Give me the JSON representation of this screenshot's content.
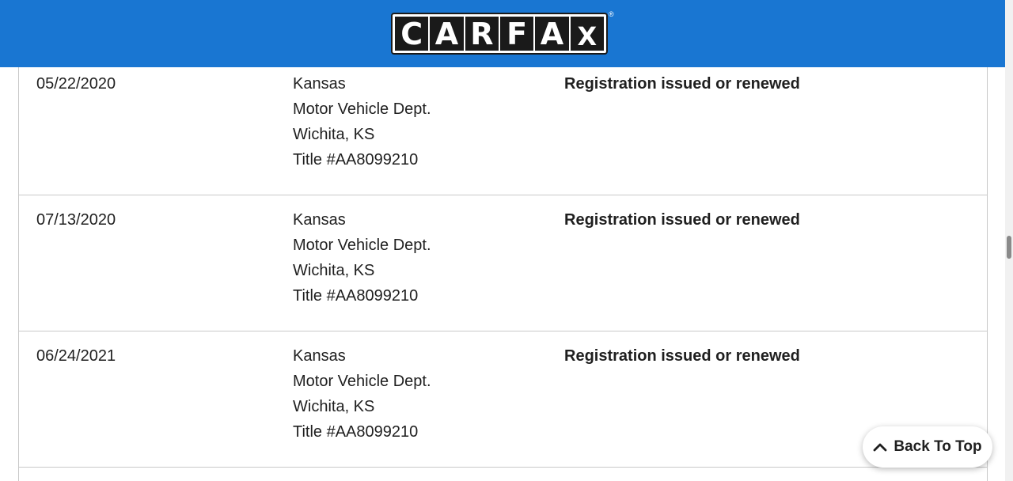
{
  "header": {
    "brand_letters": [
      "C",
      "A",
      "R",
      "F",
      "A",
      "X"
    ],
    "registered_mark": "®",
    "background_color": "#1976d2"
  },
  "records": [
    {
      "date": "05/22/2020",
      "source": [
        "Kansas",
        "Motor Vehicle Dept.",
        "Wichita, KS",
        "Title #AA8099210"
      ],
      "event": "Registration issued or renewed"
    },
    {
      "date": "07/13/2020",
      "source": [
        "Kansas",
        "Motor Vehicle Dept.",
        "Wichita, KS",
        "Title #AA8099210"
      ],
      "event": "Registration issued or renewed"
    },
    {
      "date": "06/24/2021",
      "source": [
        "Kansas",
        "Motor Vehicle Dept.",
        "Wichita, KS",
        "Title #AA8099210"
      ],
      "event": "Registration issued or renewed"
    }
  ],
  "back_to_top": {
    "label": "Back To Top",
    "icon": "chevron-up-icon"
  }
}
